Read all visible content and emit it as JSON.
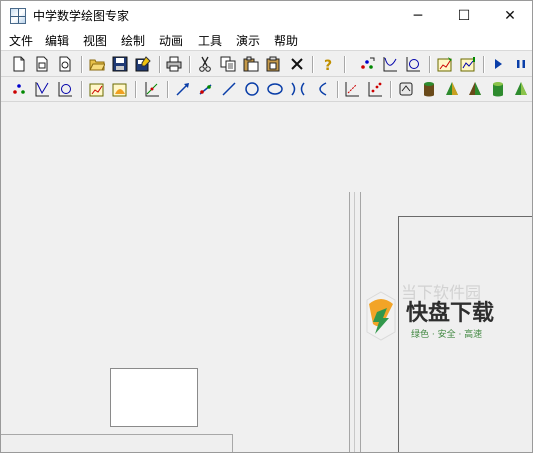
{
  "window": {
    "title": "中学数学绘图专家",
    "minimize_glyph": "─",
    "maximize_glyph": "☐",
    "close_glyph": "✕"
  },
  "menu": [
    {
      "label": "文件"
    },
    {
      "label": "编辑"
    },
    {
      "label": "视图"
    },
    {
      "label": "绘制"
    },
    {
      "label": "动画"
    },
    {
      "label": "工具"
    },
    {
      "label": "演示"
    },
    {
      "label": "帮助"
    }
  ],
  "toolbar1_icons": [
    "new-document-icon",
    "new-page-icon",
    "copy-page-icon",
    "open-folder-icon",
    "save-icon",
    "save-as-icon",
    "print-icon",
    "cut-icon",
    "copy-icon",
    "paste-icon",
    "paste-special-icon",
    "delete-icon",
    "help-icon",
    "plot-points-icon",
    "plot-curve-icon",
    "plot-circle-icon",
    "export-graph-icon",
    "import-graph-icon",
    "play-icon",
    "pause-icon"
  ],
  "toolbar2_icons": [
    "points-icon",
    "angle-icon",
    "circle-frame-icon",
    "graph-edit-icon",
    "graph-fill-icon",
    "axes-icon",
    "arrow-icon",
    "vector-icon",
    "line-icon",
    "circle-icon",
    "ellipse-icon",
    "hyperbola-icon",
    "parabola-icon",
    "coordinate-icon",
    "grid-points-icon",
    "cube-frame-icon",
    "cylinder-icon",
    "cone-icon",
    "frustum-icon",
    "prism-icon",
    "pyramid-icon"
  ],
  "watermark": {
    "faded_text": "当下软件园",
    "main_text": "快盘下载",
    "sub_text": "绿色 · 安全 · 高速"
  }
}
